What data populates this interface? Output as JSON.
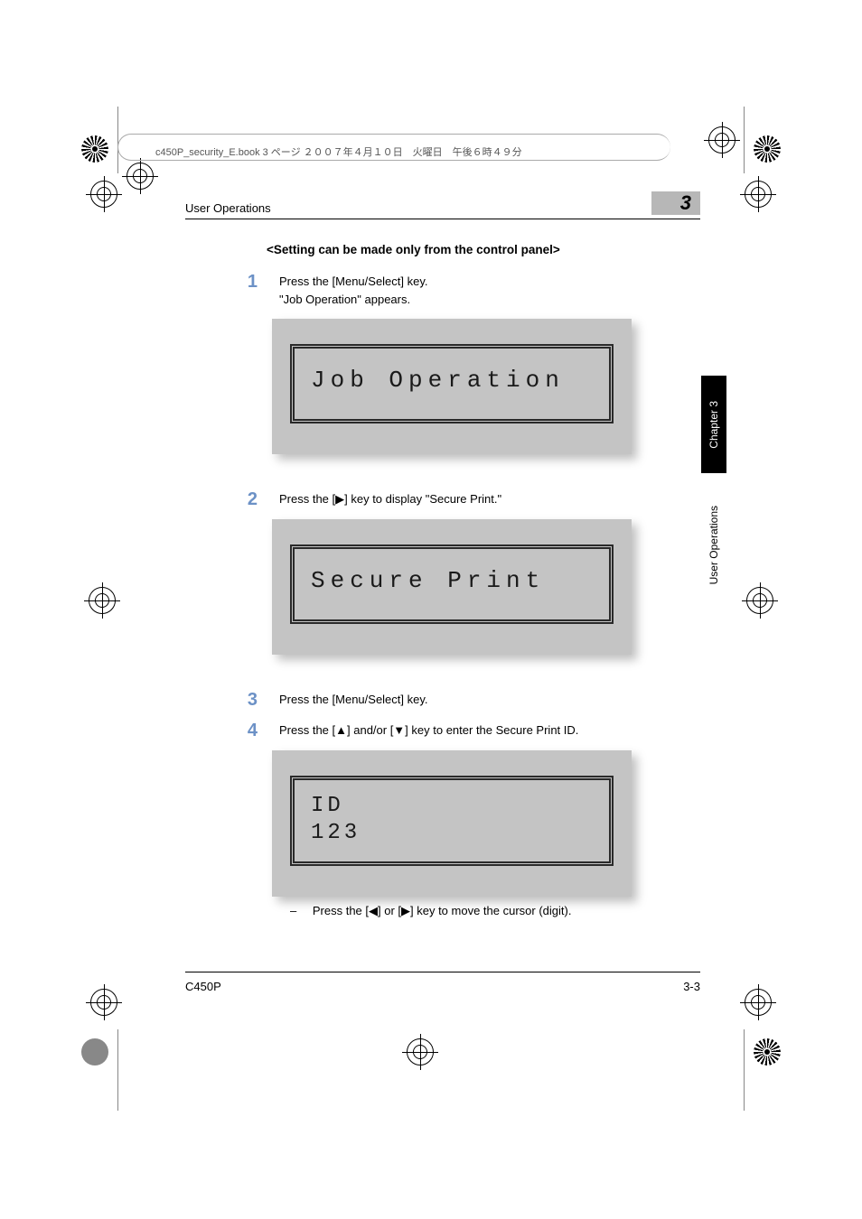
{
  "file_tag": "c450P_security_E.book  3 ページ  ２００７年４月１０日　火曜日　午後６時４９分",
  "header": {
    "section_title": "User Operations",
    "chapter_number": "3"
  },
  "subhead": "<Setting can be made only from the control panel>",
  "steps": {
    "s1": {
      "num": "1",
      "line1": "Press the [Menu/Select] key.",
      "line2": "\"Job Operation\" appears."
    },
    "s2": {
      "num": "2",
      "text": "Press the [▶] key to display \"Secure Print.\""
    },
    "s3": {
      "num": "3",
      "text": "Press the [Menu/Select] key."
    },
    "s4": {
      "num": "4",
      "text": "Press the [▲] and/or [▼] key to enter the Secure Print ID."
    }
  },
  "lcd": {
    "screen1": "Job Operation",
    "screen2": "Secure Print",
    "screen3_line1": "ID",
    "screen3_line2": "123"
  },
  "sub_bullet": "Press the [◀] or [▶] key to move the cursor (digit).",
  "side_tabs": {
    "chapter": "Chapter 3",
    "userops": "User Operations"
  },
  "footer": {
    "model": "C450P",
    "page": "3-3"
  }
}
